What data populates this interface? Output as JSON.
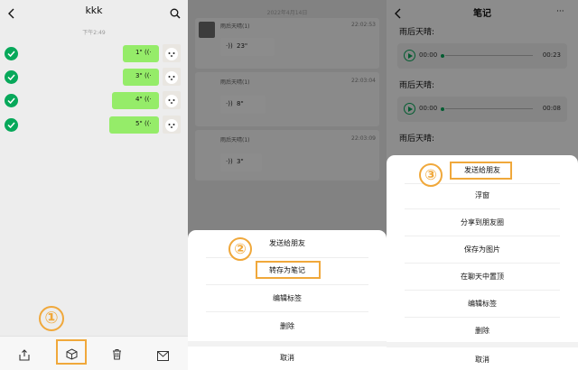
{
  "panel1": {
    "title": "kkk",
    "timestamp": "下午2:49",
    "messages": [
      {
        "duration": "1\""
      },
      {
        "duration": "3\""
      },
      {
        "duration": "4\""
      },
      {
        "duration": "5\""
      }
    ],
    "step_number": "①",
    "colors": {
      "accent": "#07a85a",
      "bubble": "#95ec69",
      "highlight": "#f0a83b"
    }
  },
  "panel2": {
    "background_date": "2022年4月14日",
    "background_messages": [
      {
        "sender": "雨后天晴(1)",
        "time": "22:02:53",
        "duration": "23\""
      },
      {
        "sender": "雨后天晴(1)",
        "time": "22:03:04",
        "duration": "8\""
      },
      {
        "sender": "雨后天晴(1)",
        "time": "22:03:09",
        "duration": "3\""
      }
    ],
    "step_number": "②",
    "menu": {
      "send_to_friend": "发送给朋友",
      "save_as_note": "转存为笔记",
      "edit_tags": "编辑标签",
      "delete": "删除",
      "cancel": "取消"
    }
  },
  "panel3": {
    "title": "笔记",
    "notes": [
      {
        "label": "雨后天晴:",
        "start": "00:00",
        "end": "00:23"
      },
      {
        "label": "雨后天晴:",
        "start": "00:00",
        "end": "00:08"
      },
      {
        "label": "雨后天晴:"
      }
    ],
    "step_number": "③",
    "menu": {
      "send_to_friend": "发送给朋友",
      "float_window": "浮窗",
      "share_moments": "分享到朋友圈",
      "save_image": "保存为图片",
      "pin_chat": "在聊天中置顶",
      "edit_tags": "编辑标签",
      "delete": "删除",
      "cancel": "取消"
    }
  }
}
